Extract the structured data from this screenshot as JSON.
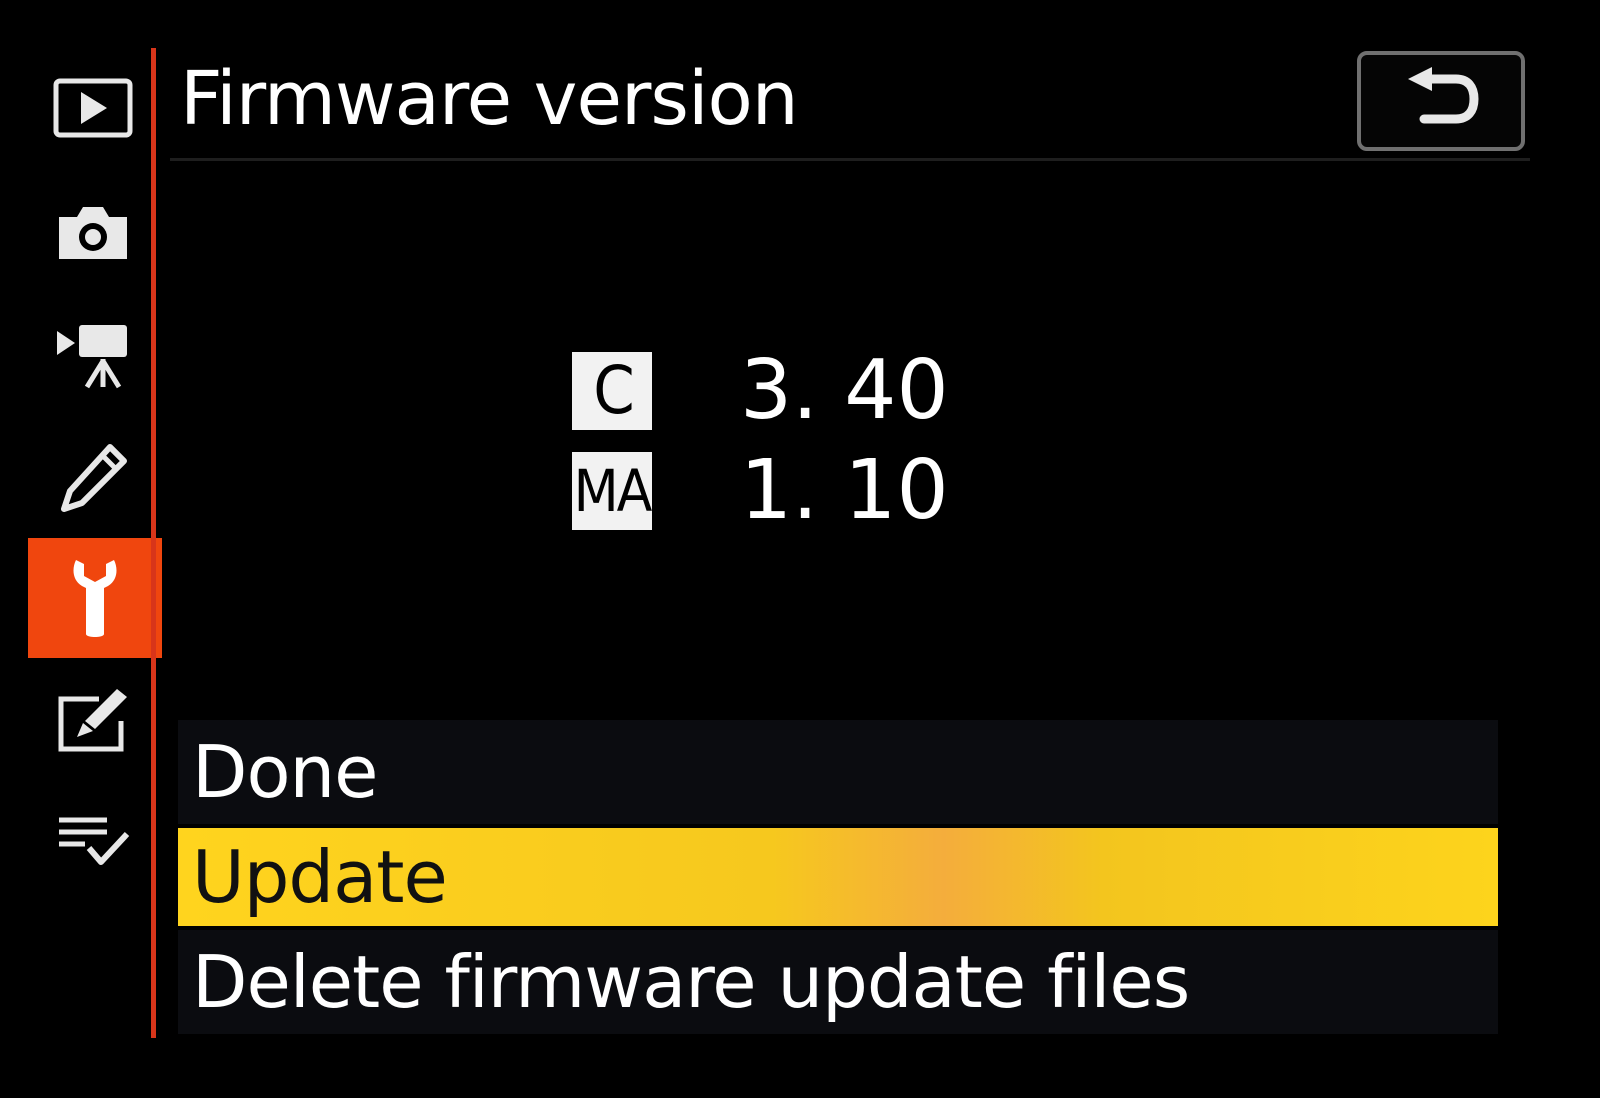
{
  "header": {
    "title": "Firmware version"
  },
  "sidebar": {
    "items": [
      {
        "name": "playback",
        "icon": "playback-icon"
      },
      {
        "name": "photo-shooting",
        "icon": "camera-icon"
      },
      {
        "name": "movie-shooting",
        "icon": "movie-camera-icon"
      },
      {
        "name": "custom-settings",
        "icon": "pencil-icon"
      },
      {
        "name": "setup",
        "icon": "wrench-icon",
        "active": true
      },
      {
        "name": "retouch",
        "icon": "retouch-icon"
      },
      {
        "name": "my-menu",
        "icon": "my-menu-icon"
      }
    ],
    "active_color": "#f0460e"
  },
  "firmware": [
    {
      "label": "C",
      "value": "3. 40"
    },
    {
      "label": "MA",
      "value": "1. 10"
    }
  ],
  "menu": {
    "items": [
      {
        "label": "Done",
        "selected": false
      },
      {
        "label": "Update",
        "selected": true
      },
      {
        "label": "Delete firmware update files",
        "selected": false
      }
    ],
    "highlight_color": "#ffd41e"
  },
  "back_button": {
    "icon": "return-arrow-icon"
  }
}
